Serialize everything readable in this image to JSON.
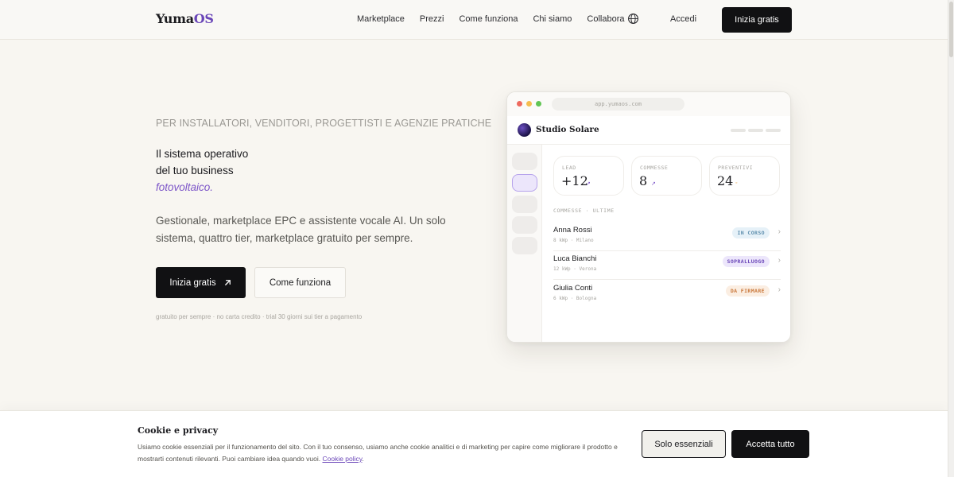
{
  "nav": {
    "logo_main": "Yuma",
    "logo_accent": "OS",
    "links": [
      "Marketplace",
      "Prezzi",
      "Come funziona",
      "Chi siamo",
      "Collabora"
    ],
    "globe_icon": "globe-icon",
    "login": "Accedi",
    "cta": "Inizia gratis"
  },
  "hero": {
    "eyebrow": "PER INSTALLATORI, VENDITORI, PROGETTISTI E AGENZIE PRATICHE",
    "headline_line1": "Il sistema operativo",
    "headline_line2": "del tuo business",
    "headline_accent": "fotovoltaico.",
    "subtitle": "Gestionale, marketplace EPC e assistente vocale AI. Un solo sistema, quattro tier, marketplace gratuito per sempre.",
    "primary_cta": "Inizia gratis",
    "primary_cta_icon": "arrow-up-right-icon",
    "secondary_cta": "Come funziona",
    "fine_print": "gratuito per sempre · no carta credito · trial 30 giorni sui tier a pagamento"
  },
  "mockup": {
    "url": "app.yumaos.com",
    "company": "Studio Solare",
    "stats": [
      {
        "label": "LEAD",
        "value": "+12",
        "trend": "↗",
        "trend_color": "#7c55c8"
      },
      {
        "label": "COMMESSE",
        "value": "8",
        "trend": "↗",
        "trend_color": "#7c55c8"
      },
      {
        "label": "PREVENTIVI",
        "value": "24",
        "trend": "◦",
        "trend_color": "#e59a3a"
      }
    ],
    "list_title": "COMMESSE · ULTIME",
    "rows": [
      {
        "name": "Anna Rossi",
        "meta": "8 kWp · Milano",
        "status": "IN CORSO",
        "badge_bg": "#e6f1f8",
        "badge_fg": "#5f8fae"
      },
      {
        "name": "Luca Bianchi",
        "meta": "12 kWp · Verona",
        "status": "SOPRALLUOGO",
        "badge_bg": "#ece6fb",
        "badge_fg": "#6a46b8"
      },
      {
        "name": "Giulia Conti",
        "meta": "6 kWp · Bologna",
        "status": "DA FIRMARE",
        "badge_bg": "#fbeee2",
        "badge_fg": "#c9773a"
      }
    ]
  },
  "cookie": {
    "title": "Cookie e privacy",
    "text": "Usiamo cookie essenziali per il funzionamento del sito. Con il tuo consenso, usiamo anche cookie analitici e di marketing per capire come migliorare il prodotto e mostrarti contenuti rilevanti. Puoi cambiare idea quando vuoi.",
    "link": "Cookie policy",
    "essential_button": "Solo essenziali",
    "accept_button": "Accetta tutto"
  }
}
